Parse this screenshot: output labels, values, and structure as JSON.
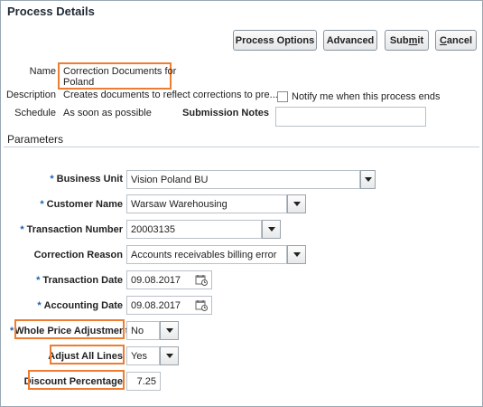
{
  "header": {
    "title": "Process Details"
  },
  "toolbar": {
    "process_options": "Process Options",
    "advanced": "Advanced",
    "submit": "Submit",
    "cancel": "Cancel"
  },
  "details": {
    "name_label": "Name",
    "name_value_line1": "Correction Documents for",
    "name_value_line2": "Poland",
    "description_label": "Description",
    "description_value": "Creates documents to reflect corrections to pre...",
    "schedule_label": "Schedule",
    "schedule_value": "As soon as possible",
    "notify_label": "Notify me when this process ends",
    "notify_checked": false,
    "submission_notes_label": "Submission Notes",
    "submission_notes_value": ""
  },
  "parameters": {
    "section_title": "Parameters",
    "required_marker": "*",
    "fields": {
      "business_unit": {
        "label": "Business Unit",
        "value": "Vision Poland BU",
        "required": true
      },
      "customer_name": {
        "label": "Customer Name",
        "value": "Warsaw Warehousing",
        "required": true
      },
      "transaction_number": {
        "label": "Transaction Number",
        "value": "20003135",
        "required": true
      },
      "correction_reason": {
        "label": "Correction Reason",
        "value": "Accounts receivables billing error",
        "required": false
      },
      "transaction_date": {
        "label": "Transaction Date",
        "value": "09.08.2017",
        "required": true
      },
      "accounting_date": {
        "label": "Accounting Date",
        "value": "09.08.2017",
        "required": true
      },
      "whole_price_adjustment": {
        "label": "Whole Price Adjustment",
        "value": "No",
        "required": true
      },
      "adjust_all_lines": {
        "label": "Adjust All Lines",
        "value": "Yes",
        "required": false
      },
      "discount_percentage": {
        "label": "Discount Percentage",
        "value": "7.25",
        "required": false
      }
    }
  },
  "colors": {
    "highlight": "#ed7d31",
    "required": "#1a62b8"
  }
}
